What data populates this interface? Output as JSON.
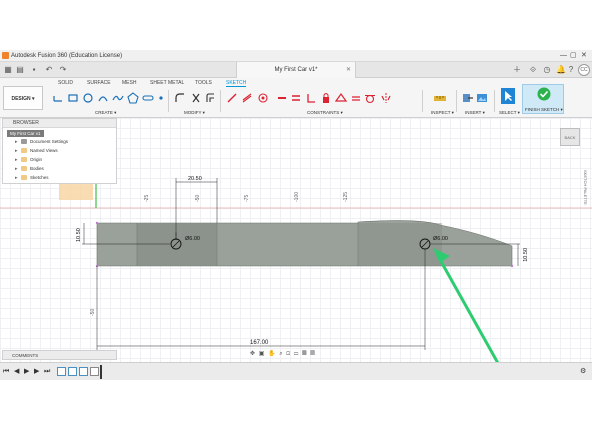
{
  "title_bar": {
    "title": "Autodesk Fusion 360 (Education License)",
    "min": "—",
    "max": "▢",
    "close": "✕"
  },
  "tab_bar": {
    "document_tab": "My First Car v1*"
  },
  "user": {
    "initials": "CC"
  },
  "ribbon": {
    "tabs": [
      "SOLID",
      "SURFACE",
      "MESH",
      "SHEET METAL",
      "TOOLS",
      "SKETCH"
    ],
    "active_tab": "SKETCH",
    "workspace": "DESIGN ▾",
    "groups": {
      "create": "CREATE ▾",
      "modify": "MODIFY ▾",
      "constraints": "CONSTRAINTS ▾",
      "inspect": "INSPECT ▾",
      "insert": "INSERT ▾",
      "select": "SELECT ▾",
      "finish": "FINISH SKETCH ▾"
    }
  },
  "browser": {
    "header": "BROWSER",
    "root": "My First Car v1",
    "items": [
      "Document Settings",
      "Named Views",
      "Origin",
      "Bodies",
      "Sketches"
    ]
  },
  "canvas": {
    "axis_ticks": [
      "-25",
      "-50",
      "-75",
      "-100",
      "-125"
    ],
    "dimensions": {
      "top_offset": "20.50",
      "left_height": "10.50",
      "right_height": "10.50",
      "hole_left": "Ø6.00",
      "hole_right": "Ø6.00",
      "hole_spacing": "167.00",
      "left_offset": "-50"
    },
    "viewcube": "BACK",
    "side_panel": "SKETCH PALETTE"
  },
  "comments": {
    "label": "COMMENTS"
  },
  "colors": {
    "accent": "#0696d7",
    "part_fill": "#9aa19a",
    "part_shade": "#848b84",
    "arrow": "#2ecc71",
    "finish": "#2bb24c"
  }
}
